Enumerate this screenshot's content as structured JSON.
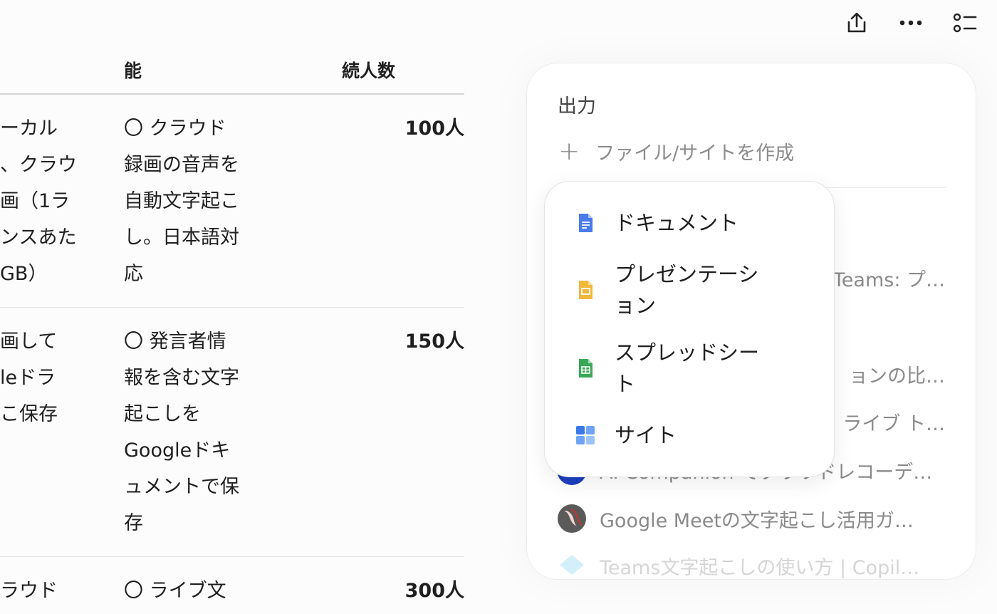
{
  "toolbar": {
    "share_icon": "share-icon",
    "more_icon": "more-icon",
    "list_icon": "checklist-icon"
  },
  "table": {
    "headers": {
      "feature": "能",
      "users": "続人数"
    },
    "rows": [
      {
        "left": [
          "ーカル",
          "、クラウ",
          "画（1ラ",
          "ンスあた",
          "GB）"
        ],
        "feature": [
          "〇 クラウド",
          "録画の音声を",
          "自動文字起こ",
          "し。日本語対",
          "応"
        ],
        "users": "100人"
      },
      {
        "left": [
          "画して",
          "leドラ",
          "こ保存"
        ],
        "feature": [
          "〇 発言者情",
          "報を含む文字",
          "起こしを",
          "Googleドキ",
          "ュメントで保",
          "存"
        ],
        "users": "150人"
      },
      {
        "left": [
          "ラウド"
        ],
        "feature": [
          "〇 ライブ文"
        ],
        "users": "300人"
      }
    ]
  },
  "panel": {
    "title": "出力",
    "create_label": "ファイル/サイトを作成",
    "history": [
      {
        "text": "Teams: プ…"
      },
      {
        "text": "ョンの比…"
      },
      {
        "text": "ライブ ト…"
      },
      {
        "text": "AI Companion でクラウドレコーデ…"
      },
      {
        "text": "Google Meetの文字起こし活用ガ…"
      },
      {
        "text": "Teams文字起こしの使い方 | Copil…"
      }
    ]
  },
  "menu": {
    "items": [
      {
        "label": "ドキュメント",
        "icon": "docs-icon",
        "color": "#4a7bed"
      },
      {
        "label": "プレゼンテーション",
        "icon": "slides-icon",
        "color": "#f0b93b"
      },
      {
        "label": "スプレッドシート",
        "icon": "sheets-icon",
        "color": "#3aa757"
      },
      {
        "label": "サイト",
        "icon": "sites-icon",
        "color": "#4a8cf0"
      }
    ]
  }
}
